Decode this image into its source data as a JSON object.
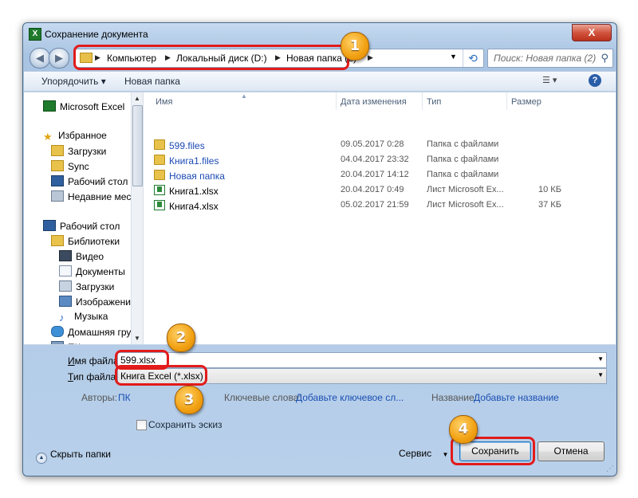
{
  "window": {
    "title": "Сохранение документа",
    "app_icon": "excel-icon",
    "close_glyph": "X"
  },
  "nav": {
    "back_icon": "back-arrow-icon",
    "forward_icon": "forward-arrow-icon",
    "breadcrumbs": [
      "Компьютер",
      "Локальный диск (D:)",
      "Новая папка (2)"
    ],
    "search_placeholder": "Поиск: Новая папка (2)"
  },
  "toolbar": {
    "organize_label": "Упорядочить ▾",
    "new_folder_label": "Новая папка",
    "help_glyph": "?"
  },
  "sidebar": {
    "items": [
      {
        "label": "Microsoft Excel",
        "icon": "excel-icon"
      },
      {
        "label": "Избранное",
        "icon": "star-icon"
      },
      {
        "label": "Загрузки",
        "icon": "downloads-icon"
      },
      {
        "label": "Sync",
        "icon": "folder-icon"
      },
      {
        "label": "Рабочий стол",
        "icon": "desktop-icon"
      },
      {
        "label": "Недавние места",
        "icon": "recent-places-icon"
      },
      {
        "label": "Рабочий стол",
        "icon": "desktop-icon"
      },
      {
        "label": "Библиотеки",
        "icon": "libraries-icon"
      },
      {
        "label": "Видео",
        "icon": "video-icon"
      },
      {
        "label": "Документы",
        "icon": "documents-icon"
      },
      {
        "label": "Загрузки",
        "icon": "downloads-icon"
      },
      {
        "label": "Изображения",
        "icon": "pictures-icon"
      },
      {
        "label": "Музыка",
        "icon": "music-icon"
      },
      {
        "label": "Домашняя груп",
        "icon": "homegroup-icon"
      },
      {
        "label": "ПК",
        "icon": "computer-icon"
      }
    ]
  },
  "files": {
    "columns": [
      "Имя",
      "Дата изменения",
      "Тип",
      "Размер"
    ],
    "rows": [
      {
        "name": "599.files",
        "date": "09.05.2017 0:28",
        "type": "Папка с файлами",
        "size": "",
        "icon": "folder-icon"
      },
      {
        "name": "Книга1.files",
        "date": "04.04.2017 23:32",
        "type": "Папка с файлами",
        "size": "",
        "icon": "folder-icon"
      },
      {
        "name": "Новая папка",
        "date": "20.04.2017 14:12",
        "type": "Папка с файлами",
        "size": "",
        "icon": "folder-icon"
      },
      {
        "name": "Книга1.xlsx",
        "date": "20.04.2017 0:49",
        "type": "Лист Microsoft Ex...",
        "size": "10 КБ",
        "icon": "xlsx-icon"
      },
      {
        "name": "Книга4.xlsx",
        "date": "05.02.2017 21:59",
        "type": "Лист Microsoft Ex...",
        "size": "37 КБ",
        "icon": "xlsx-icon"
      }
    ]
  },
  "form": {
    "filename_label_u": "И",
    "filename_label_rest": "мя файла:",
    "filename_value": "599.xlsx",
    "filetype_label_u": "Т",
    "filetype_label_rest": "ип файла:",
    "filetype_value": "Книга Excel (*.xlsx)",
    "authors_label": "Авторы:",
    "authors_value": "ПК",
    "keywords_label": "Ключевые слова:",
    "keywords_value": "Добавьте ключевое сл...",
    "title_label": "Название:",
    "title_value": "Добавьте название",
    "thumbnail_label": "Сохранить эскиз"
  },
  "footer": {
    "hide_folders_label": "Скрыть папки",
    "service_label": "Сервис",
    "save_label": "Сохранить",
    "cancel_label": "Отмена"
  },
  "annotations": {
    "badges": [
      "1",
      "2",
      "3",
      "4"
    ],
    "color": "#e21b1b",
    "badge_color": "#f1a011"
  }
}
